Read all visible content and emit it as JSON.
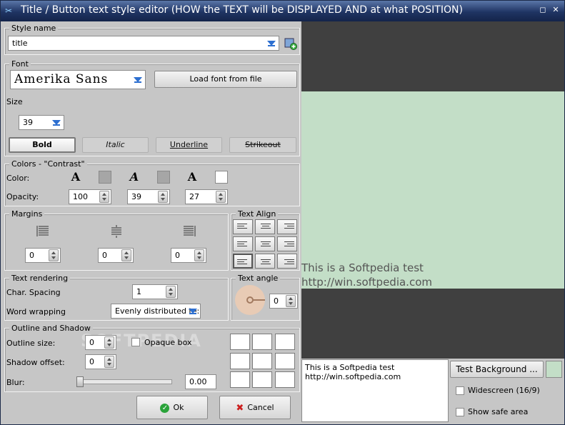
{
  "window": {
    "title": "Title / Button text style editor   (HOW the TEXT will be DISPLAYED AND at what POSITION)",
    "icon": "app-icon",
    "restore_label": "◻",
    "close_label": "✕"
  },
  "style_name": {
    "section": "Style name",
    "value": "title"
  },
  "font": {
    "section": "Font",
    "family": "Amerika Sans",
    "load_button": "Load font from file",
    "size_label": "Size",
    "size_value": "39",
    "bold": "Bold",
    "italic": "Italic",
    "underline": "Underline",
    "strikeout": "Strikeout"
  },
  "colors": {
    "section": "Colors - \"Contrast\"",
    "color_label": "Color:",
    "opacity_label": "Opacity:",
    "opacities": [
      "100",
      "39",
      "27"
    ]
  },
  "margins": {
    "section": "Margins",
    "values": [
      "0",
      "0",
      "0"
    ]
  },
  "text_align": {
    "section": "Text Align"
  },
  "text_rendering": {
    "section": "Text rendering",
    "char_spacing_label": "Char. Spacing",
    "char_spacing_value": "1",
    "word_wrapping_label": "Word wrapping",
    "word_wrapping_value": "Evenly distributed te:"
  },
  "text_angle": {
    "section": "Text angle",
    "value": "0"
  },
  "outline_shadow": {
    "section": "Outline  and Shadow",
    "outline_label": "Outline size:",
    "outline_value": "0",
    "opaque_box_label": "Opaque box",
    "shadow_label": "Shadow offset:",
    "shadow_value": "0",
    "blur_label": "Blur:",
    "blur_value": "0.00",
    "blur_level": 0
  },
  "buttons": {
    "ok": "Ok",
    "cancel": "Cancel"
  },
  "preview": {
    "line1": "This is a Softpedia test",
    "line2": "http://win.softpedia.com",
    "bg_color": "#c3dec7",
    "bar_color": "#404040"
  },
  "editor_text": {
    "line1": "This is a Softpedia test",
    "line2": "http://win.softpedia.com"
  },
  "test_background": {
    "label": "Test Background ..."
  },
  "widescreen": {
    "label": "Widescreen (16/9)"
  },
  "safe_area": {
    "label": "Show safe area"
  },
  "watermark": "SOFTPEDIA"
}
